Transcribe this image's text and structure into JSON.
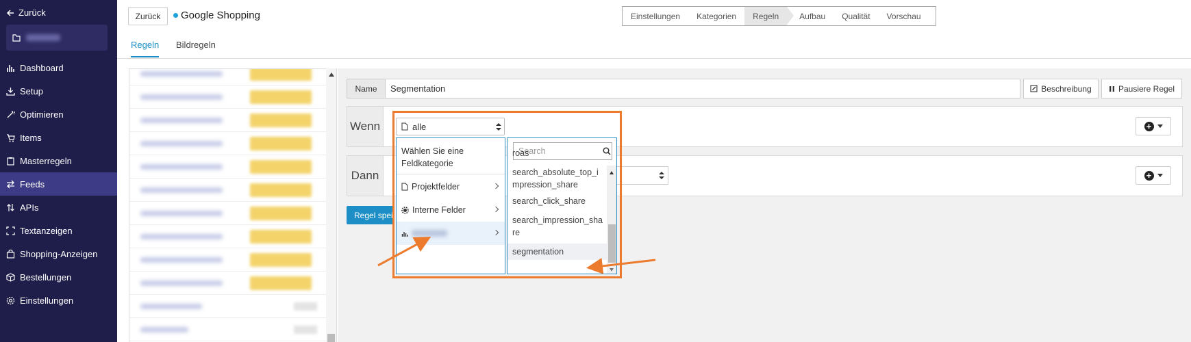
{
  "sidebar": {
    "back_label": "Zurück",
    "items": [
      {
        "label": "Dashboard",
        "icon": "bar-chart-icon"
      },
      {
        "label": "Setup",
        "icon": "download-icon"
      },
      {
        "label": "Optimieren",
        "icon": "magic-wand-icon"
      },
      {
        "label": "Items",
        "icon": "cart-icon"
      },
      {
        "label": "Masterregeln",
        "icon": "clipboard-icon"
      },
      {
        "label": "Feeds",
        "icon": "swap-icon",
        "active": true
      },
      {
        "label": "APIs",
        "icon": "up-down-arrows-icon"
      },
      {
        "label": "Textanzeigen",
        "icon": "brackets-icon"
      },
      {
        "label": "Shopping-Anzeigen",
        "icon": "shopping-bag-icon"
      },
      {
        "label": "Bestellungen",
        "icon": "box-icon"
      },
      {
        "label": "Einstellungen",
        "icon": "gear-icon"
      }
    ]
  },
  "header": {
    "back_button": "Zurück",
    "title": "Google Shopping",
    "steps": [
      "Einstellungen",
      "Kategorien",
      "Regeln",
      "Aufbau",
      "Qualität",
      "Vorschau"
    ],
    "active_step": "Regeln"
  },
  "tabs": [
    "Regeln",
    "Bildregeln"
  ],
  "rule": {
    "name_label": "Name",
    "name_value": "Segmentation",
    "description_button": "Beschreibung",
    "pause_button": "Pausiere Regel",
    "wenn_label": "Wenn",
    "dann_label": "Dann",
    "save_button": "Regel spei",
    "condition_select": "alle"
  },
  "category_dropdown": {
    "header": "Wählen Sie eine Feldkategorie",
    "items": [
      {
        "label": "Projektfelder",
        "icon": "file-icon"
      },
      {
        "label": "Interne Felder",
        "icon": "gear-icon"
      }
    ]
  },
  "field_dropdown": {
    "search_placeholder": "Search",
    "items": [
      "roas",
      "search_absolute_top_impression_share",
      "search_click_share",
      "search_impression_share",
      "segmentation"
    ]
  },
  "colors": {
    "sidebar_bg": "#1f1d4a",
    "accent": "#1e8fc6",
    "highlight_orange": "#ec7b2d"
  }
}
